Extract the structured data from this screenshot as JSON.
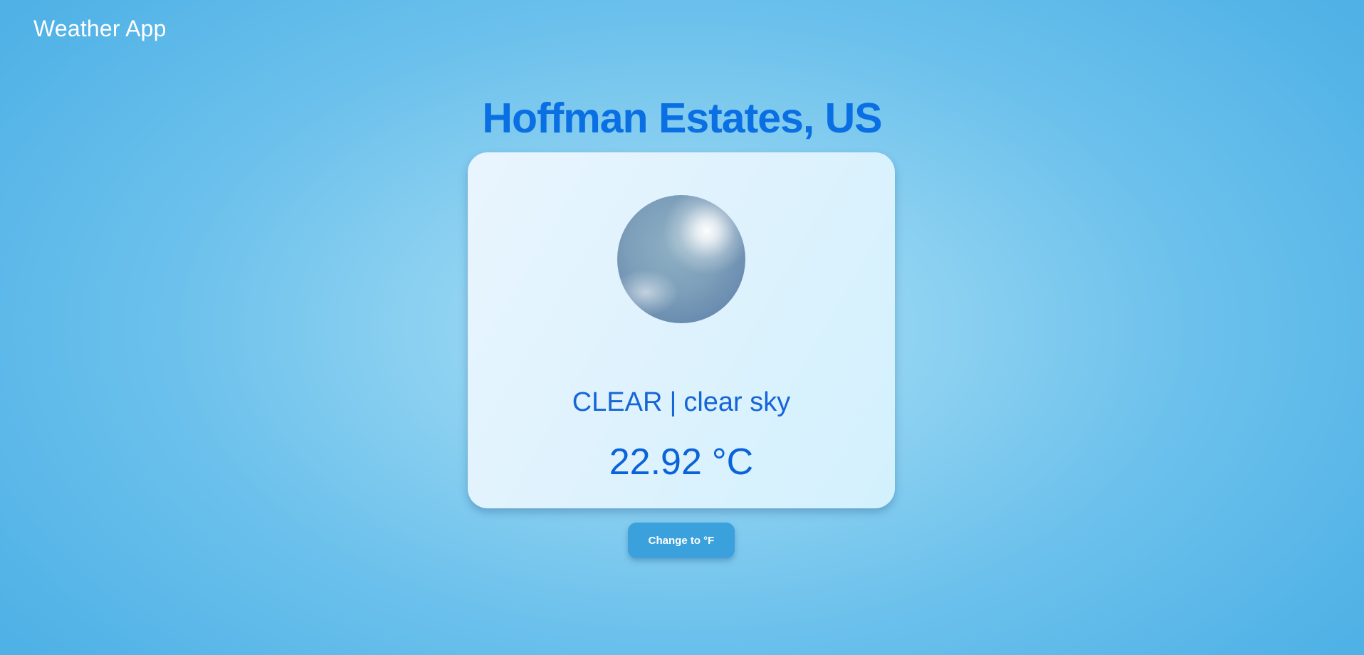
{
  "header": {
    "app_title": "Weather App"
  },
  "location": {
    "city": "Hoffman Estates, US"
  },
  "weather": {
    "icon": "clear-sky-orb-icon",
    "main": "CLEAR",
    "separator": "|",
    "description": "clear sky",
    "temperature": "22.92",
    "unit": "°C"
  },
  "actions": {
    "change_unit_label": "Change to °F"
  },
  "colors": {
    "accent": "#0a6fe3",
    "button": "#3aa1dc",
    "card": "#e4f4fd"
  }
}
